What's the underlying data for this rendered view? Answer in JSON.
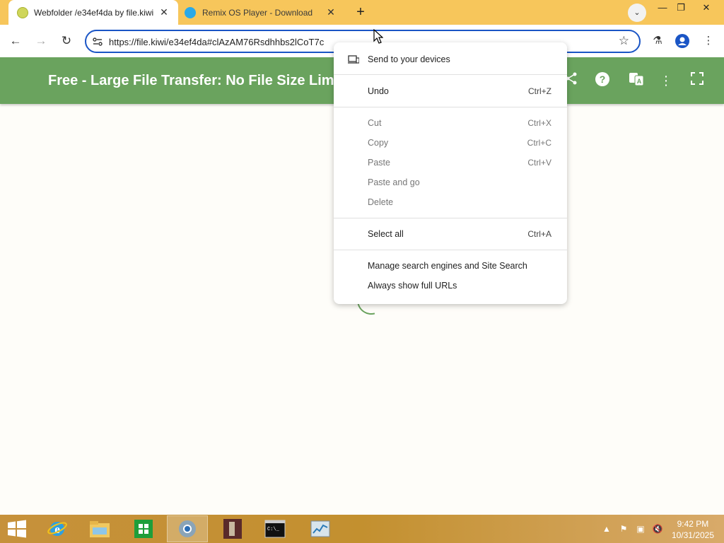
{
  "tabs": [
    {
      "title": "Webfolder /e34ef4da by file.kiwi",
      "active": true
    },
    {
      "title": "Remix OS Player - Download",
      "active": false
    }
  ],
  "toolbar": {
    "url": "https://file.kiwi/e34ef4da#clAzAM76Rsdhhbs2lCoT7c"
  },
  "site": {
    "title": "Free - Large File Transfer: No File Size Limit"
  },
  "context_menu": {
    "items": [
      {
        "label": "Send to your devices",
        "shortcut": "",
        "disabled": false
      },
      {
        "label": "Undo",
        "shortcut": "Ctrl+Z",
        "disabled": false
      },
      {
        "label": "Cut",
        "shortcut": "Ctrl+X",
        "disabled": true
      },
      {
        "label": "Copy",
        "shortcut": "Ctrl+C",
        "disabled": true
      },
      {
        "label": "Paste",
        "shortcut": "Ctrl+V",
        "disabled": true
      },
      {
        "label": "Paste and go",
        "shortcut": "",
        "disabled": true
      },
      {
        "label": "Delete",
        "shortcut": "",
        "disabled": true
      },
      {
        "label": "Select all",
        "shortcut": "Ctrl+A",
        "disabled": false
      },
      {
        "label": "Manage search engines and Site Search",
        "shortcut": "",
        "disabled": false
      },
      {
        "label": "Always show full URLs",
        "shortcut": "",
        "disabled": false
      }
    ]
  },
  "taskbar": {
    "time": "9:42 PM",
    "date": "10/31/2025"
  },
  "colors": {
    "tab_strip": "#f7c65b",
    "site_header": "#6aa35e",
    "omnibox_border": "#1a55c5",
    "taskbar": "#c6913b"
  }
}
